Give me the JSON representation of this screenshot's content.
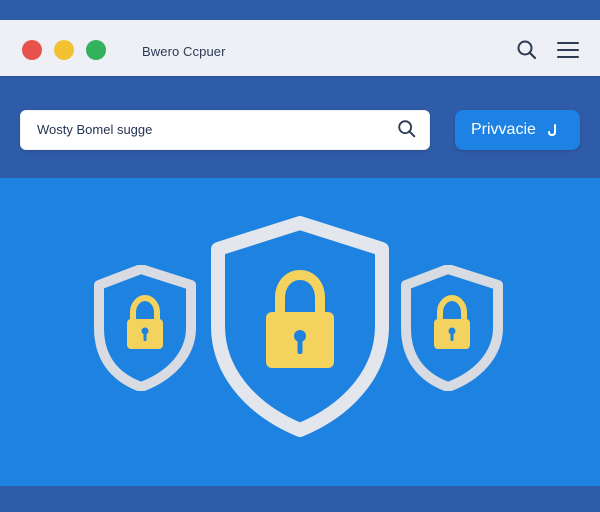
{
  "window": {
    "title": "Bwero Ccpuer"
  },
  "header": {
    "search_icon": "search-icon",
    "menu_icon": "menu-icon"
  },
  "search": {
    "value": "Wosty Bomel sugge",
    "icon": "search-icon"
  },
  "actions": {
    "privacy_label": "Privvacie",
    "privacy_icon": "chevron-icon"
  },
  "illustration": {
    "items": [
      {
        "icon": "shield-lock-icon"
      },
      {
        "icon": "shield-lock-icon"
      },
      {
        "icon": "shield-lock-icon"
      }
    ]
  },
  "colors": {
    "frame": "#2f5ca8",
    "content": "#1e82e1",
    "button": "#1d82e3",
    "lock": "#f3d35d"
  }
}
